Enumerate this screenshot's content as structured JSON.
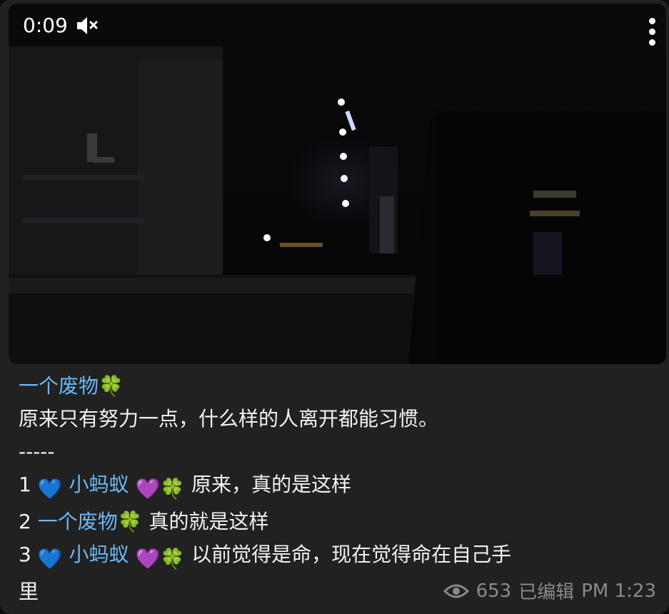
{
  "video": {
    "time": "0:09",
    "muted_icon": "speaker-muted-icon",
    "menu_icon": "more-vertical-icon"
  },
  "message": {
    "author": "一个废物🍀",
    "line1": "原来只有努力一点，什么样的人离开都能习惯。",
    "divider": "-----",
    "items": [
      {
        "num": "1",
        "name": "小蚂蚁",
        "text": "原来，真的是这样"
      },
      {
        "num": "2",
        "name": "一个废物🍀",
        "text": "真的就是这样"
      },
      {
        "num": "3",
        "name": "小蚂蚁",
        "text": "以前觉得是命，现在觉得命在自己手"
      }
    ],
    "wrap": "里"
  },
  "footer": {
    "views": "653",
    "edited": "已编辑",
    "time": "PM 1:23",
    "eye_icon": "eye-icon"
  },
  "colors": {
    "link": "#6bb8f5",
    "bubble": "#212121",
    "footer_text": "#8a8a8a"
  }
}
